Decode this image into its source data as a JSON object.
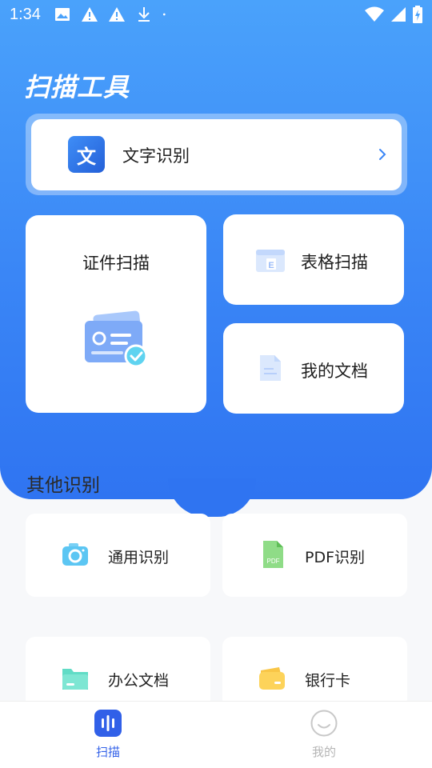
{
  "status_bar": {
    "time": "1:34",
    "icons": [
      "image-icon",
      "warning-icon",
      "warning-icon",
      "download-icon",
      "dot-icon",
      "wifi-icon",
      "signal-icon",
      "battery-icon"
    ]
  },
  "header": {
    "title": "扫描工具"
  },
  "ocr_card": {
    "icon_glyph": "文",
    "label": "文字识别"
  },
  "feature_cards": {
    "id_scan": "证件扫描",
    "table_scan": "表格扫描",
    "my_docs": "我的文档"
  },
  "other_section": {
    "title": "其他识别",
    "items": [
      {
        "label": "通用识别",
        "icon": "camera-icon"
      },
      {
        "label": "PDF识别",
        "icon": "pdf-file-icon"
      },
      {
        "label": "办公文档",
        "icon": "folder-icon"
      },
      {
        "label": "银行卡",
        "icon": "wallet-icon"
      }
    ]
  },
  "tabbar": {
    "tabs": [
      {
        "label": "扫描",
        "active": true
      },
      {
        "label": "我的",
        "active": false
      }
    ]
  },
  "colors": {
    "accent": "#2f74f1",
    "tab_active": "#3160e8",
    "tab_inactive": "#b5b5b5"
  }
}
